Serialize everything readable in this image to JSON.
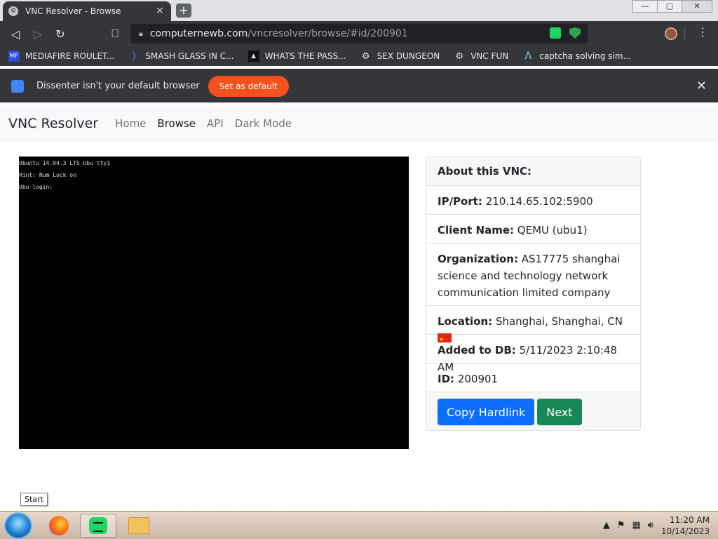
{
  "browser": {
    "tab_title": "VNC Resolver - Browse",
    "tab_close": "✕",
    "new_tab": "+",
    "window_controls": {
      "minimize": "—",
      "maximize": "▢",
      "close": "✕"
    },
    "url_host": "computernewb.com",
    "url_path": "/vncresolver/browse/#id/200901",
    "menu_icon": "⋮"
  },
  "bookmarks": [
    {
      "icon": "mf-icon",
      "label": "MEDIAFIRE ROULET..."
    },
    {
      "icon": "glass-icon",
      "label": "SMASH GLASS IN C..."
    },
    {
      "icon": "dark-square-icon",
      "label": "WHATS THE PASS..."
    },
    {
      "icon": "gear-icon",
      "label": "SEX DUNGEON"
    },
    {
      "icon": "gear-icon",
      "label": "VNC FUN"
    },
    {
      "icon": "lambda-icon",
      "label": "captcha solving sim..."
    }
  ],
  "infobar": {
    "message": "Dissenter isn't your default browser",
    "button": "Set as default",
    "close": "✕"
  },
  "site": {
    "brand": "VNC Resolver",
    "nav": [
      "Home",
      "Browse",
      "API",
      "Dark Mode"
    ],
    "active_nav": "Browse"
  },
  "screenshot_text": [
    "Ubuntu 14.04.3 LTS Ubu tty1",
    "Hint: Num Lock on",
    "Ubu login:"
  ],
  "card": {
    "header": "About this VNC:",
    "ip_label": "IP/Port:",
    "ip_value": "210.14.65.102:5900",
    "client_label": "Client Name:",
    "client_value": "QEMU (ubu1)",
    "org_label": "Organization:",
    "org_value": "AS17775 shanghai science and technology network communication limited company",
    "loc_label": "Location:",
    "loc_value": "Shanghai, Shanghai, CN",
    "added_label": "Added to DB:",
    "added_value": "5/11/2023 2:10:48 AM",
    "id_label": "ID:",
    "id_value": "200901",
    "copy_button": "Copy Hardlink",
    "next_button": "Next",
    "colors": {
      "primary": "#0d6efd",
      "success": "#198754"
    }
  },
  "taskbar": {
    "tooltip": "Start",
    "time": "11:20 AM",
    "date": "10/14/2023"
  }
}
